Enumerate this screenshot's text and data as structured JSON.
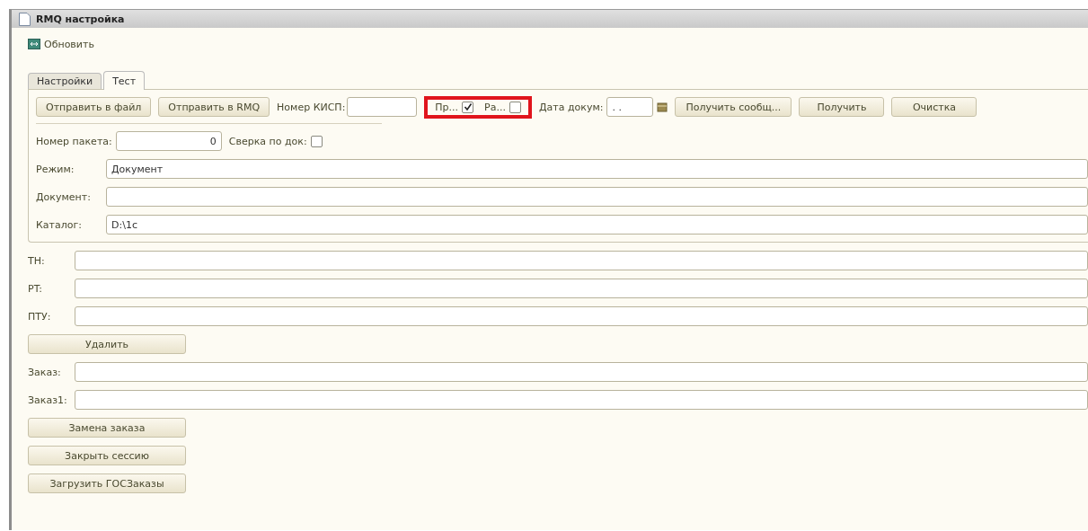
{
  "window": {
    "title": "RMQ настройка"
  },
  "toolbar": {
    "label": "Обновить"
  },
  "tabs": [
    {
      "label": "Настройки",
      "selected": false
    },
    {
      "label": "Тест",
      "selected": true
    }
  ],
  "top_row": [
    {
      "kind": "button",
      "label": "Отправить в файл"
    },
    {
      "kind": "button",
      "label": "Отправить в RMQ"
    },
    {
      "kind": "field",
      "label": "Номер КИСП:"
    },
    {
      "kind": "highlight",
      "items": [
        {
          "label": "Пр...",
          "checked": true
        },
        {
          "label": "Ра...",
          "checked": false
        }
      ]
    },
    {
      "kind": "date",
      "label": "Дата докум:",
      "value": ". ."
    },
    {
      "kind": "button",
      "label": "Получить сообщ..."
    },
    {
      "kind": "button",
      "label": "Получить"
    },
    {
      "kind": "button",
      "label": "Очистка"
    }
  ],
  "package": {
    "label": "Номер пакета:",
    "value": "0"
  },
  "doc_check": {
    "label": "Сверка по док:",
    "checked": false
  },
  "panel_fields": [
    {
      "label": "Режим:",
      "value": "Документ"
    },
    {
      "label": "Документ:"
    },
    {
      "label": "Каталог:",
      "value": "D:\\1c"
    }
  ],
  "lower": [
    {
      "kind": "field",
      "label": "TH:"
    },
    {
      "kind": "field",
      "label": "PT:"
    },
    {
      "kind": "field",
      "label": "ПТУ:"
    },
    {
      "kind": "button",
      "label": "Удалить"
    },
    {
      "kind": "field",
      "label": "Заказ:"
    },
    {
      "kind": "field",
      "label": "Заказ1:"
    },
    {
      "kind": "button",
      "label": "Замена заказа"
    },
    {
      "kind": "button",
      "label": "Закрыть сессию"
    },
    {
      "kind": "button",
      "label": "Загрузить ГОСЗаказы"
    }
  ]
}
